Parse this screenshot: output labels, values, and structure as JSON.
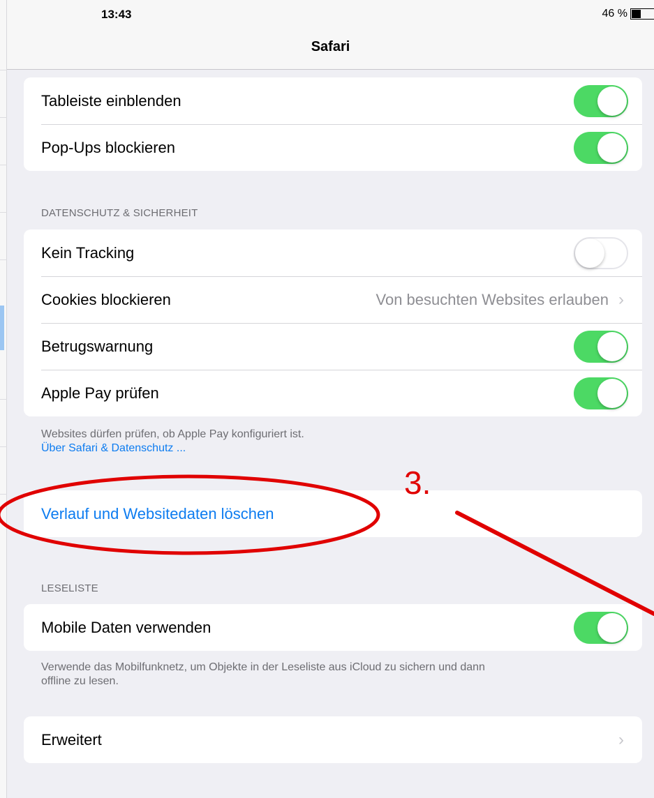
{
  "status_bar": {
    "time": "13:43",
    "battery": "46 %"
  },
  "nav": {
    "title": "Safari"
  },
  "top_group": {
    "rows": [
      {
        "label": "Tableiste einblenden",
        "toggle": true
      },
      {
        "label": "Pop-Ups blockieren",
        "toggle": true
      }
    ]
  },
  "privacy": {
    "header": "DATENSCHUTZ & SICHERHEIT",
    "rows": [
      {
        "label": "Kein Tracking",
        "toggle": false
      },
      {
        "label": "Cookies blockieren",
        "value": "Von besuchten Websites erlauben"
      },
      {
        "label": "Betrugswarnung",
        "toggle": true
      },
      {
        "label": "Apple Pay prüfen",
        "toggle": true
      }
    ],
    "footer": "Websites dürfen prüfen, ob Apple Pay konfiguriert ist.",
    "footer_link": "Über Safari & Datenschutz ..."
  },
  "clear_history": {
    "label": "Verlauf und Websitedaten löschen"
  },
  "reading_list": {
    "header": "LESELISTE",
    "row": {
      "label": "Mobile Daten verwenden",
      "toggle": true
    },
    "footer_line1": "Verwende das Mobilfunknetz, um Objekte in der Leseliste aus iCloud zu sichern und dann",
    "footer_line2": "offline zu lesen."
  },
  "advanced": {
    "label": "Erweitert"
  },
  "annotation": {
    "step_label": "3.",
    "color": "#e00000"
  },
  "colors": {
    "accent": "#0d7cf0",
    "toggle_on": "#4cd964",
    "background": "#efeff4"
  }
}
